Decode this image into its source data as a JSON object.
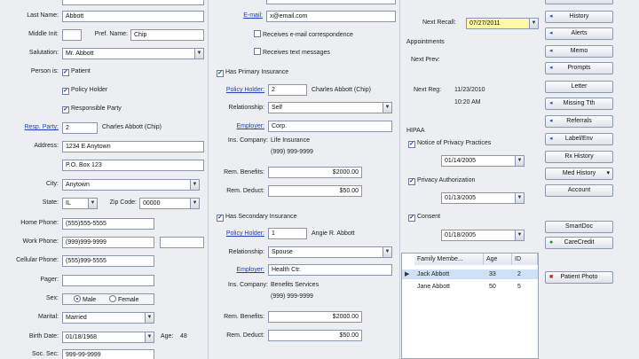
{
  "left": {
    "last_name_label": "Last Name:",
    "last_name": "Abbott",
    "middle_init_label": "Middle Init:",
    "middle_init": "",
    "pref_name_label": "Pref. Name:",
    "pref_name": "Chip",
    "salutation_label": "Salutation:",
    "salutation": "Mr. Abbott",
    "person_is_label": "Person is:",
    "cb_patient": "Patient",
    "cb_policy_holder": "Policy Holder",
    "cb_responsible": "Responsible Party",
    "resp_party_label": "Resp. Party:",
    "resp_party_num": "2",
    "resp_party_name": "Charles Abbott (Chip)",
    "address_label": "Address:",
    "address1": "1234 E Anytown",
    "address2": "P.O. Box 123",
    "city_label": "City:",
    "city": "Anytown",
    "state_label": "State:",
    "state": "IL",
    "zip_label": "Zip Code:",
    "zip": "00000",
    "home_phone_label": "Home Phone:",
    "home_phone": "(555)555-5555",
    "work_phone_label": "Work Phone:",
    "work_phone": "(999)999-9999",
    "cell_phone_label": "Cellular Phone:",
    "cell_phone": "(555)999-5555",
    "pager_label": "Pager:",
    "pager": "",
    "sex_label": "Sex:",
    "sex_male": "Male",
    "sex_female": "Female",
    "marital_label": "Marital:",
    "marital": "Married",
    "birth_date_label": "Birth Date:",
    "birth_date": "01/18/1968",
    "age_label": "Age:",
    "age": "48",
    "soc_sec_label": "Soc. Sec:",
    "soc_sec": "999-99-9999"
  },
  "middle": {
    "email_label": "E-mail:",
    "email": "x@email.com",
    "cb_receives_email": "Receives e-mail correspondence",
    "cb_receives_text": "Receives text messages",
    "cb_primary_ins": "Has Primary Insurance",
    "primary": {
      "policy_holder_label": "Policy Holder:",
      "policy_holder_num": "2",
      "policy_holder_name": "Charles Abbott (Chip)",
      "relationship_label": "Relationship:",
      "relationship": "Self",
      "employer_label": "Employer:",
      "employer": "Corp.",
      "ins_company_label": "Ins. Company:",
      "ins_company": "Life Insurance",
      "ins_phone": "(999) 999-9999",
      "rem_benefits_label": "Rem. Benefits:",
      "rem_benefits": "$2000.00",
      "rem_deduct_label": "Rem. Deduct:",
      "rem_deduct": "$50.00"
    },
    "cb_secondary_ins": "Has Secondary Insurance",
    "secondary": {
      "policy_holder_label": "Policy Holder:",
      "policy_holder_num": "1",
      "policy_holder_name": "Angie R. Abbott",
      "relationship_label": "Relationship:",
      "relationship": "Spouse",
      "employer_label": "Employer:",
      "employer": "Health Ctr.",
      "ins_company_label": "Ins. Company:",
      "ins_company": "Benefits Services",
      "ins_phone": "(999) 999-9999",
      "rem_benefits_label": "Rem. Benefits:",
      "rem_benefits": "$2000.00",
      "rem_deduct_label": "Rem. Deduct:",
      "rem_deduct": "$50.00"
    }
  },
  "right": {
    "next_recall_label": "Next Recall:",
    "next_recall": "07/27/2011",
    "appointments_label": "Appointments",
    "next_prev_label": "Next Prev:",
    "next_reg_label": "Next Reg:",
    "next_reg_date": "11/23/2010",
    "next_reg_time": "10:20 AM",
    "hipaa_label": "HIPAA",
    "cb_notice": "Notice of Privacy Practices",
    "notice_date": "01/14/2005",
    "cb_privacy_auth": "Privacy Authorization",
    "privacy_auth_date": "01/13/2005",
    "cb_consent": "Consent",
    "consent_date": "01/18/2005",
    "family": {
      "headers": [
        "Family Membe...",
        "Age",
        "ID"
      ],
      "rows": [
        {
          "name": "Jack Abbott",
          "age": "33",
          "id": "2"
        },
        {
          "name": "Jane Abbott",
          "age": "50",
          "id": "5"
        }
      ]
    }
  },
  "buttons": {
    "history": "History",
    "alerts": "Alerts",
    "memo": "Memo",
    "prompts": "Prompts",
    "letter": "Letter",
    "missing_tth": "Missing Tth",
    "referrals": "Referrals",
    "label_env": "Label/Env",
    "rx_history": "Rx History",
    "med_history": "Med History",
    "account": "Account",
    "smartdoc": "SmartDoc",
    "carecredit": "CareCredit",
    "patient_photo": "Patient Photo"
  }
}
